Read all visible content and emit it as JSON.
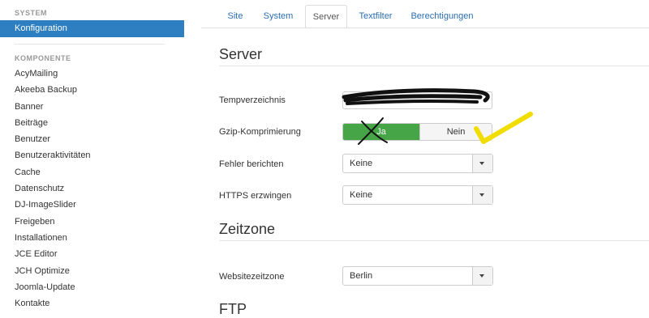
{
  "sidebar": {
    "system_heading": "SYSTEM",
    "active_item": "Konfiguration",
    "components_heading": "KOMPONENTE",
    "items": [
      {
        "label": "AcyMailing"
      },
      {
        "label": "Akeeba Backup"
      },
      {
        "label": "Banner"
      },
      {
        "label": "Beiträge"
      },
      {
        "label": "Benutzer"
      },
      {
        "label": "Benutzeraktivitäten"
      },
      {
        "label": "Cache"
      },
      {
        "label": "Datenschutz"
      },
      {
        "label": "DJ-ImageSlider"
      },
      {
        "label": "Freigeben"
      },
      {
        "label": "Installationen"
      },
      {
        "label": "JCE Editor"
      },
      {
        "label": "JCH Optimize"
      },
      {
        "label": "Joomla-Update"
      },
      {
        "label": "Kontakte"
      }
    ]
  },
  "tabs": [
    {
      "label": "Site"
    },
    {
      "label": "System"
    },
    {
      "label": "Server",
      "active": true
    },
    {
      "label": "Textfilter"
    },
    {
      "label": "Berechtigungen"
    }
  ],
  "server": {
    "title": "Server",
    "temp_label": "Tempverzeichnis",
    "temp_value": "",
    "gzip_label": "Gzip-Komprimierung",
    "gzip_yes": "Ja",
    "gzip_no": "Nein",
    "error_label": "Fehler berichten",
    "error_value": "Keine",
    "https_label": "HTTPS erzwingen",
    "https_value": "Keine"
  },
  "timezone": {
    "title": "Zeitzone",
    "label": "Websitezeitzone",
    "value": "Berlin"
  },
  "ftp": {
    "title": "FTP"
  },
  "colors": {
    "accent": "#2d7fc1",
    "toggle_yes": "#46a546",
    "scribble_black": "#111111",
    "check_yellow": "#f2dd00"
  }
}
